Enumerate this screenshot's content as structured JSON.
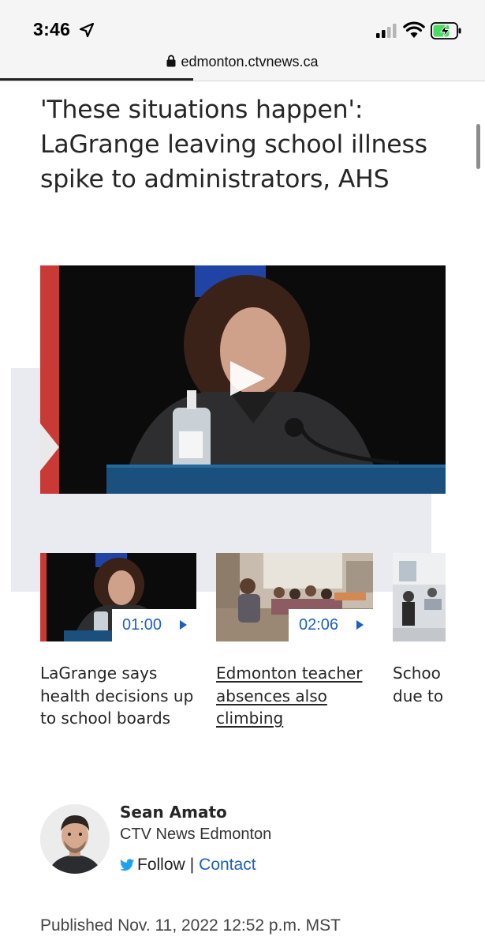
{
  "status_bar": {
    "time": "3:46",
    "icons": [
      "location-arrow-icon",
      "cellular-signal-icon",
      "wifi-icon",
      "battery-charging-icon"
    ]
  },
  "url_bar": {
    "url": "edmonton.ctvnews.ca",
    "icon": "lock-icon"
  },
  "article": {
    "headline": "'These situations happen': LaGrange leaving school illness spike to administrators, AHS",
    "video": {
      "icon": "play-icon"
    }
  },
  "related_videos": [
    {
      "duration": "01:00",
      "title": "LaGrange says health decisions up to school boards"
    },
    {
      "duration": "02:06",
      "title": "Edmonton teacher absences also climbing"
    },
    {
      "title_lines": [
        "Schoo",
        "due to"
      ]
    }
  ],
  "author": {
    "name": "Sean Amato",
    "organization": "CTV News Edmonton",
    "follow_label": "Follow",
    "separator": "|",
    "contact_label": "Contact"
  },
  "published": "Published Nov. 11, 2022 12:52 p.m. MST",
  "colors": {
    "link_blue": "#1d5fbf",
    "twitter_blue": "#1da1f2",
    "headline_text": "#262626",
    "backdrop_grey": "#e9ebf0",
    "battery_green": "#4cd964"
  }
}
